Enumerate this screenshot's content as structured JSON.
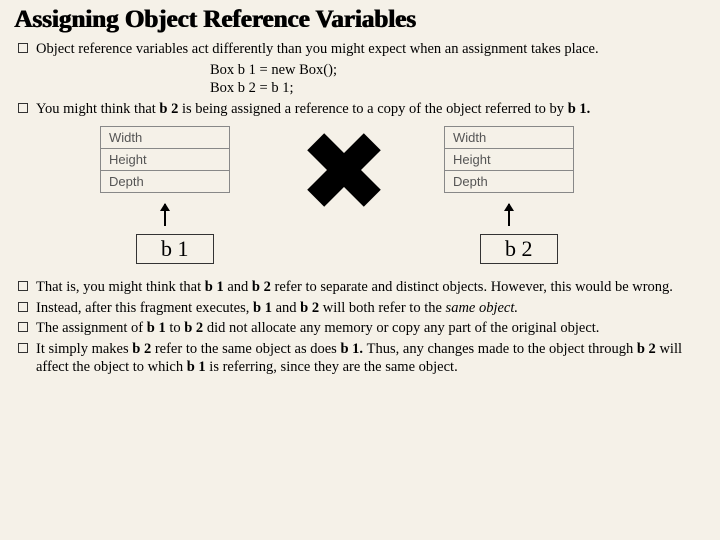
{
  "title": "Assigning Object Reference Variables",
  "top_bullets": [
    "Object reference variables act differently than you might expect when an assignment takes place."
  ],
  "code": {
    "line1": "Box b 1 = new Box();",
    "line2": "Box b 2 = b 1;"
  },
  "mid_bullet_pre": "You might think that ",
  "mid_bullet_bold1": "b 2",
  "mid_bullet_mid1": " is being assigned a reference to a copy of the object referred to by ",
  "mid_bullet_bold2": "b 1.",
  "diagram": {
    "row1": "Width",
    "row2": "Height",
    "row3": "Depth",
    "label_b1": "b 1",
    "label_b2": "b 2"
  },
  "bottom": {
    "p1_a": "That is, you might think that ",
    "p1_b1": "b 1",
    "p1_b": " and ",
    "p1_b2": "b 2",
    "p1_c": " refer to separate and distinct objects. However, this would be wrong.",
    "p2_a": "Instead, after this fragment executes, ",
    "p2_b1": "b 1",
    "p2_b": " and ",
    "p2_b2": "b 2",
    "p2_c": " will both refer to the ",
    "p2_it": "same object.",
    "p3_a": "The assignment of ",
    "p3_b1": "b 1",
    "p3_b": " to ",
    "p3_b2": "b 2",
    "p3_c": " did not allocate any memory or copy any part of the ",
    "p3_d": "original ",
    "p3_e": "object.",
    "p4_a": "It simply makes ",
    "p4_b1": "b 2",
    "p4_b": " refer to the same object as does ",
    "p4_b2": "b 1. ",
    "p4_c": "Thus, any changes made to the object through ",
    "p4_b3": "b 2",
    "p4_d": " will affect the object to which ",
    "p4_b4": "b 1",
    "p4_e": " is referring, since they are the same object."
  }
}
